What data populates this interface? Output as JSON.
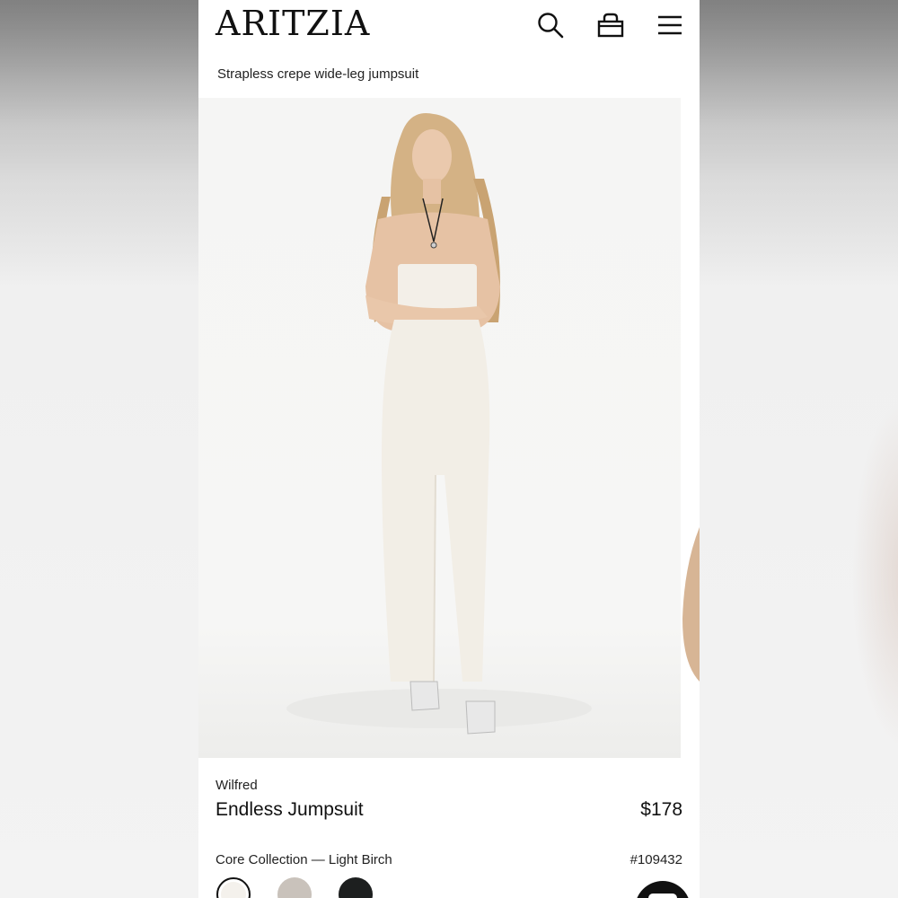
{
  "header": {
    "logo": "ARITZIA",
    "search_icon": "search-icon",
    "bag_icon": "shopping-bag-icon",
    "menu_icon": "hamburger-menu-icon"
  },
  "product": {
    "subtitle": "Strapless crepe wide-leg jumpsuit",
    "brand": "Wilfred",
    "name": "Endless Jumpsuit",
    "price": "$178",
    "colorway": "Core Collection — Light Birch",
    "sku": "#109432",
    "swatches": [
      {
        "name": "Light Birch",
        "color": "#f4f1ec",
        "selected": true
      },
      {
        "name": "Taupe",
        "color": "#c9c2bb",
        "selected": false
      },
      {
        "name": "Black",
        "color": "#1d1f1f",
        "selected": false
      }
    ]
  },
  "chat_icon": "chat-icon"
}
